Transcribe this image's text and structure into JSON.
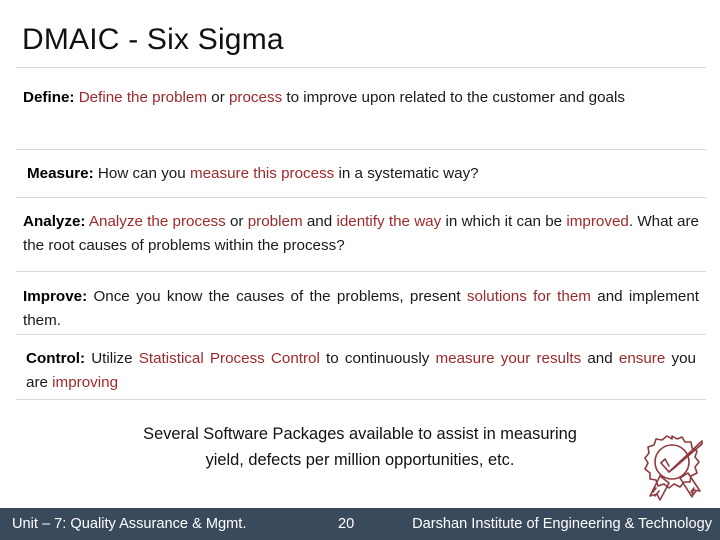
{
  "slide": {
    "title": "DMAIC  - Six Sigma",
    "background_color": "#ffffff",
    "accent_color": "#9c2a2d",
    "footer_color": "#3a4a5d",
    "divider_color": "#d8d8d8"
  },
  "sections": [
    {
      "id": "define",
      "lead": "Define:",
      "runs": [
        {
          "text": " Define the problem",
          "color": "accent"
        },
        {
          "text": " or ",
          "color": "normal"
        },
        {
          "text": "process",
          "color": "accent"
        },
        {
          "text": " to improve upon related to the customer and goals",
          "color": "normal"
        }
      ],
      "plain": "Define: Define the problem or process to improve upon related to the customer and goals"
    },
    {
      "id": "measure",
      "lead": "Measure:",
      "runs": [
        {
          "text": " How can you ",
          "color": "normal"
        },
        {
          "text": "measure this process",
          "color": "accent"
        },
        {
          "text": " in a systematic way?",
          "color": "normal"
        }
      ],
      "plain": "Measure: How can you measure this process in a systematic way?"
    },
    {
      "id": "analyze",
      "lead": "Analyze:",
      "runs": [
        {
          "text": " Analyze the process",
          "color": "accent"
        },
        {
          "text": " or ",
          "color": "normal"
        },
        {
          "text": "problem",
          "color": "accent"
        },
        {
          "text": " and ",
          "color": "normal"
        },
        {
          "text": "identify the way",
          "color": "accent"
        },
        {
          "text": " in which it can be ",
          "color": "normal"
        },
        {
          "text": "improved",
          "color": "accent"
        },
        {
          "text": ". What are the root causes of problems within the process?",
          "color": "normal"
        }
      ],
      "plain": "Analyze: Analyze the process or problem and identify the way in which it can be improved. What are the root causes of problems within the process?"
    },
    {
      "id": "improve",
      "lead": "Improve:",
      "runs": [
        {
          "text": " Once you know the causes of the problems, present ",
          "color": "normal"
        },
        {
          "text": "solutions for them",
          "color": "accent"
        },
        {
          "text": " and implement them.",
          "color": "normal"
        }
      ],
      "plain": "Improve: Once you know the causes of the problems, present solutions for them and implement them."
    },
    {
      "id": "control",
      "lead": "Control:",
      "runs": [
        {
          "text": " Utilize ",
          "color": "normal"
        },
        {
          "text": "Statistical Process Control",
          "color": "accent"
        },
        {
          "text": " to continuously ",
          "color": "normal"
        },
        {
          "text": "measure your results",
          "color": "accent"
        },
        {
          "text": " and ",
          "color": "normal"
        },
        {
          "text": "ensure",
          "color": "accent"
        },
        {
          "text": " you are ",
          "color": "normal"
        },
        {
          "text": "improving",
          "color": "accent"
        }
      ],
      "plain": "Control: Utilize Statistical Process Control to continuously measure your results and ensure you are improving"
    }
  ],
  "note": {
    "line1": "Several Software Packages available to assist in measuring",
    "line2": "yield, defects per million opportunities, etc."
  },
  "seal": {
    "icon": "award-seal-check-icon",
    "color": "#8e3a3f"
  },
  "footer": {
    "left": "Unit – 7: Quality Assurance & Mgmt.",
    "page": "20",
    "right": "Darshan Institute of Engineering & Technology"
  }
}
